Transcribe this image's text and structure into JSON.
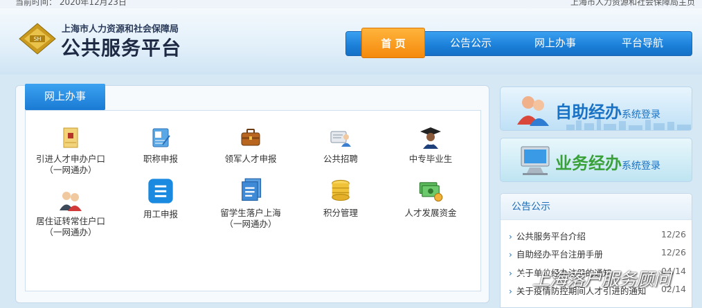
{
  "topbar": {
    "time_text": "当前时间：  2020年12月23日",
    "right_link": "上海市人力资源和社会保障局主页"
  },
  "header": {
    "org_name": "上海市人力资源和社会保障局",
    "platform_title": "公共服务平台"
  },
  "nav": {
    "items": [
      "首 页",
      "公告公示",
      "网上办事",
      "平台导航"
    ],
    "active_index": 0
  },
  "main": {
    "tab_title": "网上办事",
    "services": [
      {
        "label": "引进人才申办户口",
        "sub": "（一网通办）",
        "icon": "envelope-icon"
      },
      {
        "label": "职称申报",
        "sub": "",
        "icon": "certificate-icon"
      },
      {
        "label": "领军人才申报",
        "sub": "",
        "icon": "briefcase-icon"
      },
      {
        "label": "公共招聘",
        "sub": "",
        "icon": "recruit-icon"
      },
      {
        "label": "中专毕业生",
        "sub": "",
        "icon": "graduate-icon"
      },
      {
        "label": "居住证转常住户口",
        "sub": "（一网通办）",
        "icon": "residents-icon"
      },
      {
        "label": "用工申报",
        "sub": "",
        "icon": "list-icon"
      },
      {
        "label": "留学生落户上海",
        "sub": "（一网通办）",
        "icon": "documents-icon"
      },
      {
        "label": "积分管理",
        "sub": "",
        "icon": "coins-icon"
      },
      {
        "label": "人才发展资金",
        "sub": "",
        "icon": "money-icon"
      }
    ]
  },
  "side": {
    "self_service": {
      "title": "自助经办",
      "suffix": "系统登录"
    },
    "business": {
      "title": "业务经办",
      "suffix": "系统登录"
    }
  },
  "notice": {
    "title": "公告公示",
    "items": [
      {
        "text": "公共服务平台介绍",
        "date": "12/26"
      },
      {
        "text": "自助经办平台注册手册",
        "date": "12/26"
      },
      {
        "text": "关于单位经办注册的通知",
        "date": "04/14"
      },
      {
        "text": "关于疫情防控期间人才引进的通知",
        "date": "02/14"
      }
    ]
  },
  "watermark": {
    "text": "上海落户服务顾问"
  },
  "colors": {
    "nav_blue": "#1b7fd8",
    "nav_active": "#f58a0c",
    "link_blue": "#1a6bb8",
    "green": "#3aa13a"
  }
}
